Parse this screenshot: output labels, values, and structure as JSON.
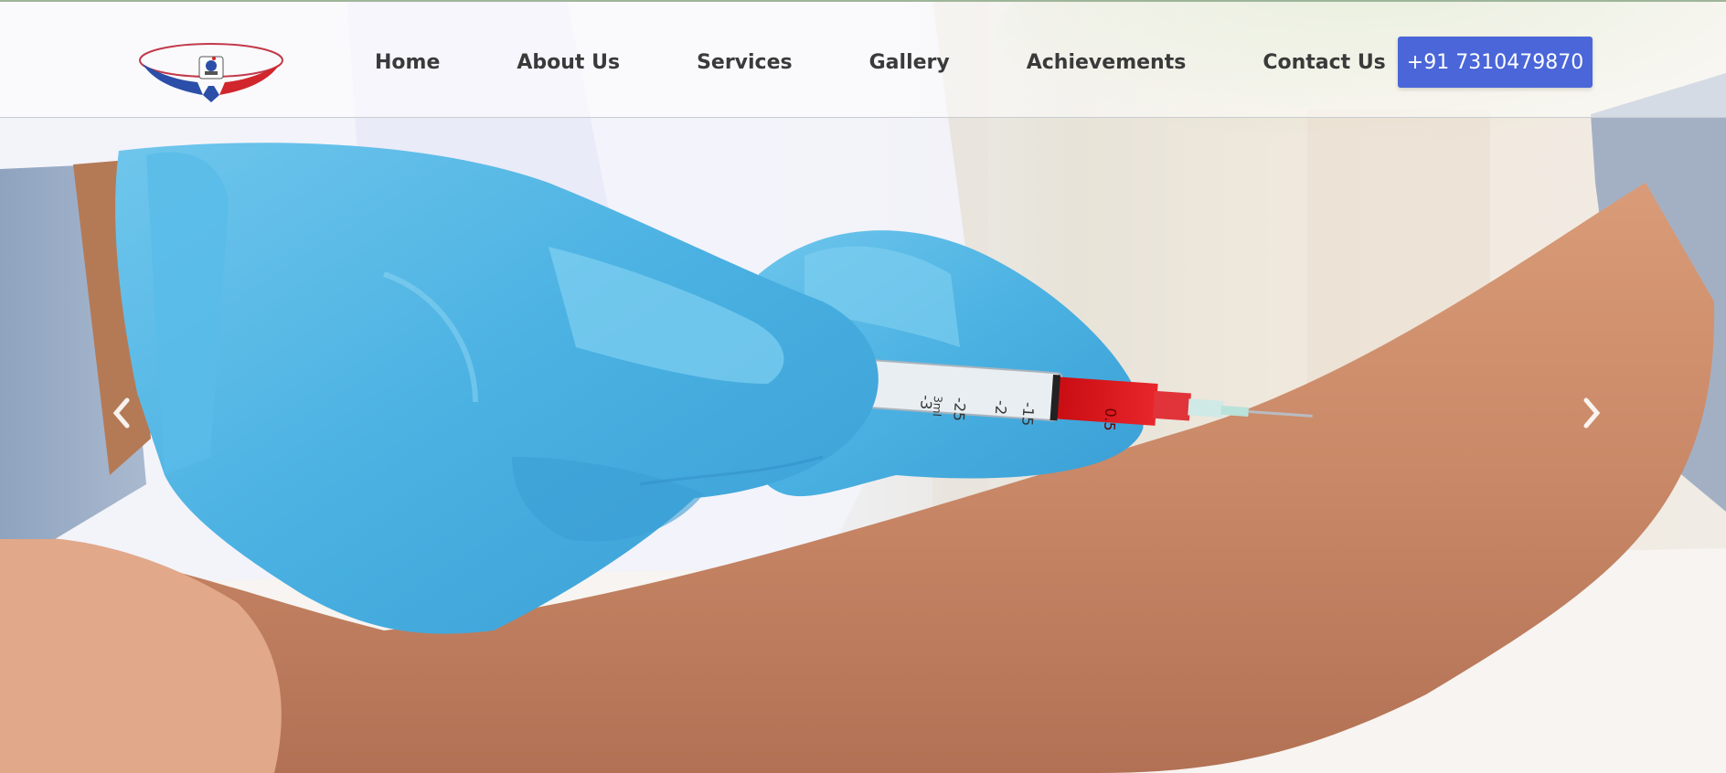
{
  "header": {
    "logo_icon": "hands-microscope-logo",
    "nav": [
      {
        "label": "Home"
      },
      {
        "label": "About Us"
      },
      {
        "label": "Services"
      },
      {
        "label": "Gallery"
      },
      {
        "label": "Achievements"
      },
      {
        "label": "Contact Us"
      }
    ],
    "phone": "+91 7310479870",
    "phone_color": "#4a66d8"
  },
  "hero": {
    "image": "gloved-hands-drawing-blood-syringe",
    "syringe_markings": [
      "-15",
      "-2",
      "-25",
      "-3",
      "3ml"
    ],
    "syringe_label": "0.5"
  },
  "carousel": {
    "prev_icon": "chevron-left-icon",
    "next_icon": "chevron-right-icon"
  }
}
